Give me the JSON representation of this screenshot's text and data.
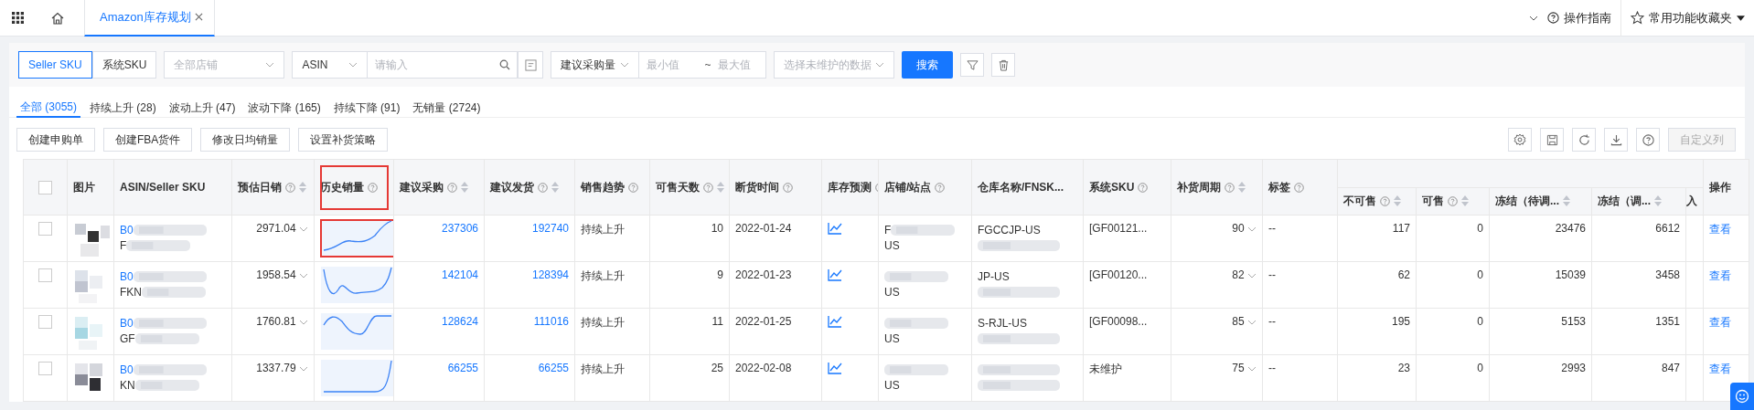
{
  "top_bar": {
    "tabs": [
      {
        "label": "Amazon库存规划",
        "selected": true
      }
    ],
    "guide": "操作指南",
    "favorites": "常用功能收藏夹"
  },
  "filters": {
    "sku_types": [
      {
        "label": "Seller SKU",
        "selected": true
      },
      {
        "label": "系统SKU",
        "selected": false
      }
    ],
    "store_placeholder": "全部店铺",
    "search_field": "ASIN",
    "search_placeholder": "请输入",
    "qty_field": "建议采购量",
    "min_placeholder": "最小值",
    "range_separator": "~",
    "max_placeholder": "最大值",
    "unmaintained_placeholder": "选择未维护的数据",
    "search_button": "搜索"
  },
  "status_tabs": [
    {
      "label": "全部 (3055)",
      "selected": true
    },
    {
      "label": "持续上升 (28)",
      "selected": false
    },
    {
      "label": "波动上升 (47)",
      "selected": false
    },
    {
      "label": "波动下降 (165)",
      "selected": false
    },
    {
      "label": "持续下降 (91)",
      "selected": false
    },
    {
      "label": "无销量 (2724)",
      "selected": false
    }
  ],
  "actions": [
    "创建申购单",
    "创建FBA货件",
    "修改日均销量",
    "设置补货策略"
  ],
  "custom_columns": "自定义列",
  "table": {
    "columns": [
      {
        "label": "图片",
        "help": false,
        "sortable": false,
        "highlighted": false
      },
      {
        "label": "ASIN/Seller SKU",
        "help": false,
        "sortable": false,
        "highlighted": false
      },
      {
        "label": "预估日销",
        "help": true,
        "sortable": true,
        "highlighted": false
      },
      {
        "label": "历史销量",
        "help": true,
        "sortable": false,
        "highlighted": true
      },
      {
        "label": "建议采购",
        "help": true,
        "sortable": true,
        "highlighted": false
      },
      {
        "label": "建议发货",
        "help": true,
        "sortable": true,
        "highlighted": false
      },
      {
        "label": "销售趋势",
        "help": true,
        "sortable": false,
        "highlighted": false
      },
      {
        "label": "可售天数",
        "help": true,
        "sortable": true,
        "highlighted": false
      },
      {
        "label": "断货时间",
        "help": true,
        "sortable": false,
        "highlighted": false
      },
      {
        "label": "库存预测",
        "help": true,
        "sortable": false,
        "highlighted": false
      },
      {
        "label": "店铺/站点",
        "help": true,
        "sortable": false,
        "highlighted": false
      },
      {
        "label": "仓库名称/FNSK...",
        "help": false,
        "sortable": false,
        "highlighted": false
      },
      {
        "label": "系统SKU",
        "help": true,
        "sortable": false,
        "highlighted": false
      },
      {
        "label": "补货周期",
        "help": true,
        "sortable": true,
        "highlighted": false
      },
      {
        "label": "标签",
        "help": true,
        "sortable": false,
        "highlighted": false
      }
    ],
    "sub_columns": [
      {
        "label": "不可售",
        "help": true,
        "sortable": true
      },
      {
        "label": "可售",
        "help": true,
        "sortable": true
      },
      {
        "label": "冻结（待调...",
        "help": false,
        "sortable": true
      },
      {
        "label": "冻结（调...",
        "help": false,
        "sortable": true
      },
      {
        "label": "入",
        "help": false,
        "sortable": false
      }
    ],
    "action_column": "操作",
    "all_checked": false,
    "rows": [
      {
        "checked": false,
        "asin": "B0",
        "sku": "F",
        "daily": "2971.04",
        "trend_highlighted": true,
        "purchase": "237306",
        "ship": "192740",
        "sales_trend": "持续上升",
        "days": "10",
        "stockout": "2022-01-24",
        "store": "F",
        "site": "US",
        "fnsku": "FGCCJP-US",
        "system_sku": "[GF00121...",
        "cycle": "90",
        "tag": "--",
        "unsellable": "117",
        "sellable": "0",
        "frozen_pending": "23476",
        "frozen": "6612",
        "action": "查看"
      },
      {
        "checked": false,
        "asin": "B0",
        "sku": "FKN",
        "daily": "1958.54",
        "trend_highlighted": false,
        "purchase": "142104",
        "ship": "128394",
        "sales_trend": "持续上升",
        "days": "9",
        "stockout": "2022-01-23",
        "site": "US",
        "fnsku": "JP-US",
        "system_sku": "[GF00120...",
        "cycle": "82",
        "tag": "--",
        "unsellable": "62",
        "sellable": "0",
        "frozen_pending": "15039",
        "frozen": "3458",
        "action": "查看"
      },
      {
        "checked": false,
        "asin": "B0",
        "sku": "GF",
        "daily": "1760.81",
        "trend_highlighted": false,
        "purchase": "128624",
        "ship": "111016",
        "sales_trend": "持续上升",
        "days": "11",
        "stockout": "2022-01-25",
        "site": "US",
        "fnsku": "S-RJL-US",
        "system_sku": "[GF00098...",
        "cycle": "85",
        "tag": "--",
        "unsellable": "195",
        "sellable": "0",
        "frozen_pending": "5153",
        "frozen": "1351",
        "action": "查看"
      },
      {
        "checked": false,
        "asin": "B0",
        "sku": "KN",
        "daily": "1337.79",
        "trend_highlighted": false,
        "purchase": "66255",
        "ship": "66255",
        "sales_trend": "持续上升",
        "days": "25",
        "stockout": "2022-02-08",
        "site": "US",
        "system_sku": "未维护",
        "cycle": "75",
        "tag": "--",
        "unsellable": "23",
        "sellable": "0",
        "frozen_pending": "2993",
        "frozen": "847",
        "action": "查看"
      }
    ]
  }
}
